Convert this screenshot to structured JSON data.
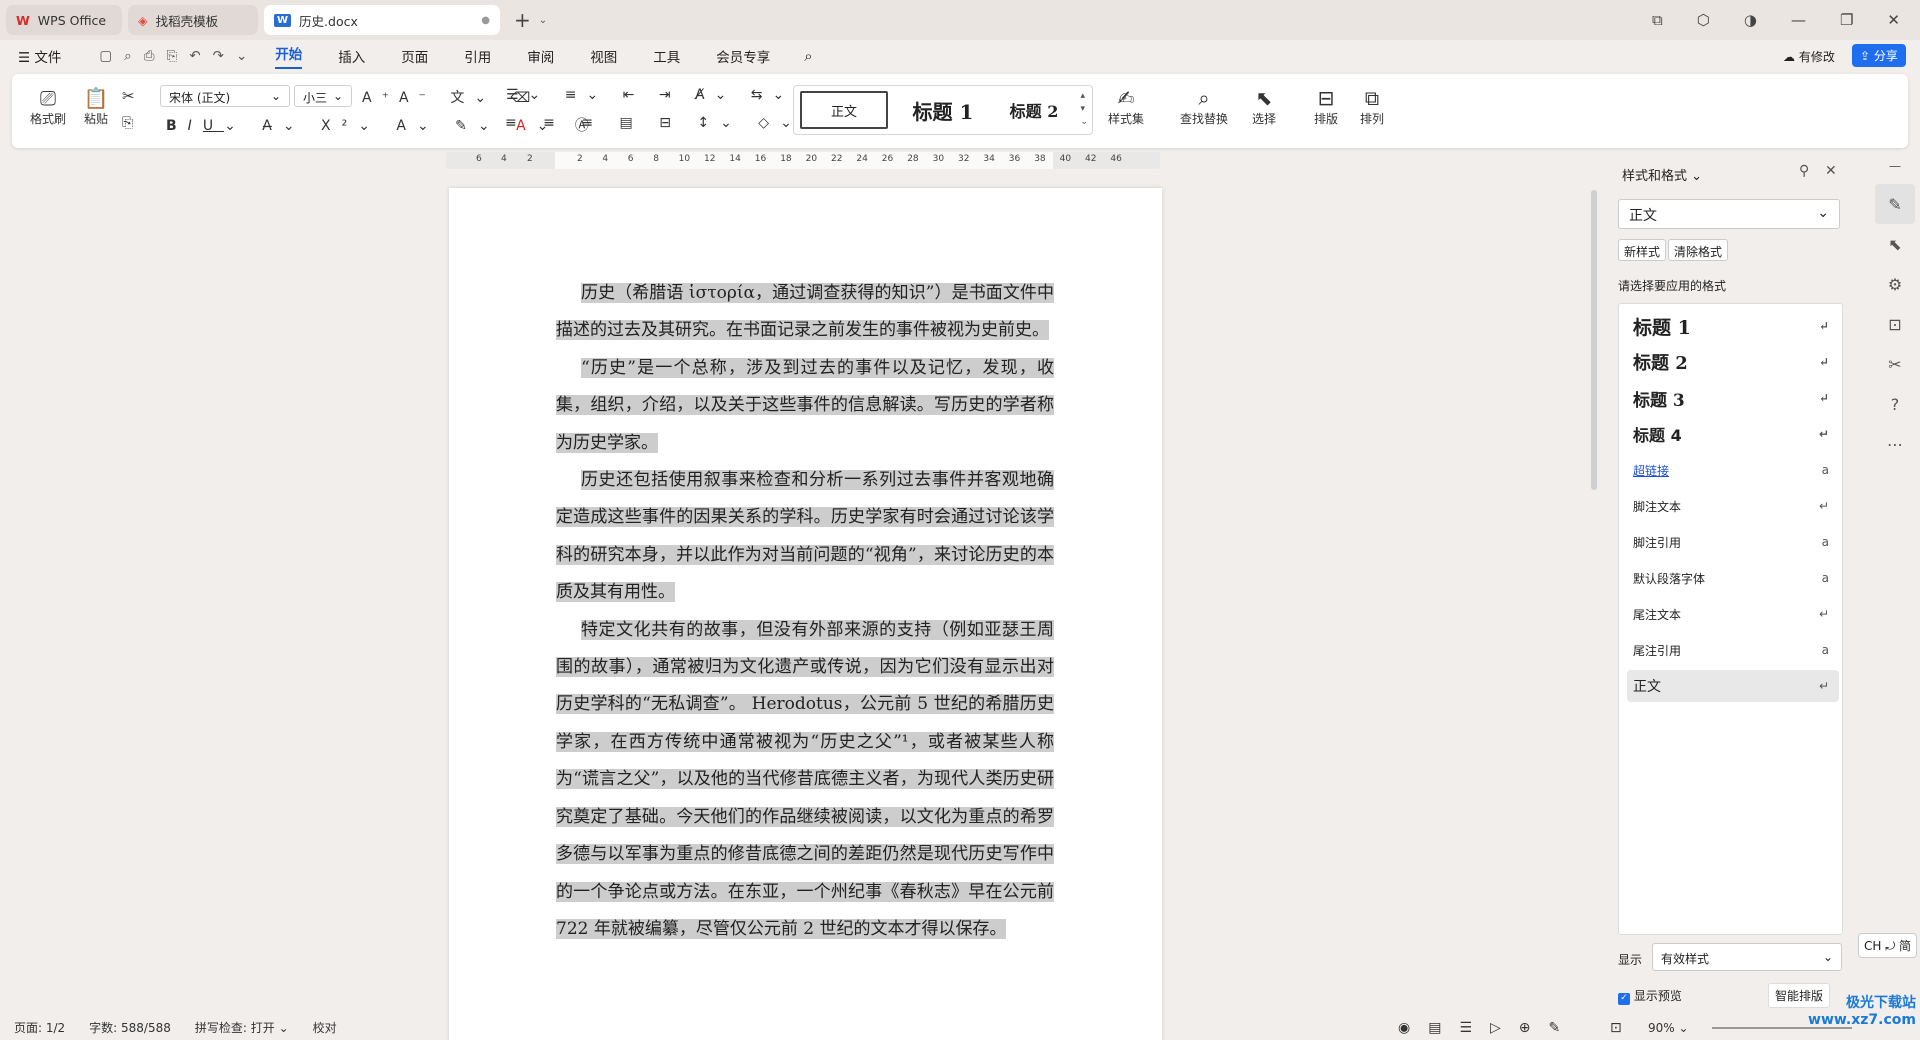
{
  "tabs": [
    {
      "label": "WPS Office",
      "icon": "wps-logo-icon"
    },
    {
      "label": "找稻壳模板",
      "icon": "daoke-icon"
    },
    {
      "label": "历史.docx",
      "icon": "word-doc-icon"
    }
  ],
  "menu": {
    "file": "文件",
    "items": [
      "开始",
      "插入",
      "页面",
      "引用",
      "审阅",
      "视图",
      "工具",
      "会员专享"
    ],
    "active": "开始",
    "modified": "有修改",
    "share": "分享"
  },
  "ribbon": {
    "format_painter": "格式刷",
    "paste": "粘贴",
    "font": "宋体 (正文)",
    "size": "小三",
    "styles_label": "样式集",
    "find_replace": "查找替换",
    "select": "选择",
    "layout": "排版",
    "arrange": "排列",
    "style_samples": [
      "正文",
      "标题 1",
      "标题 2"
    ]
  },
  "ruler": {
    "left_marks": [
      "6",
      "4",
      "2"
    ],
    "marks": [
      "2",
      "4",
      "6",
      "8",
      "10",
      "12",
      "14",
      "16",
      "18",
      "20",
      "22",
      "24",
      "26",
      "28",
      "30",
      "32",
      "34",
      "36",
      "38",
      "40",
      "42",
      "46"
    ]
  },
  "document": {
    "paragraphs": [
      "历史（希腊语 ἱστορία，通过调查获得的知识”）是书面文件中描述的过去及其研究。在书面记录之前发生的事件被视为史前史。",
      "“历史”是一个总称，涉及到过去的事件以及记忆，发现，收集，组织，介绍，以及关于这些事件的信息解读。写历史的学者称为历史学家。",
      "历史还包括使用叙事来检查和分析一系列过去事件并客观地确定造成这些事件的因果关系的学科。历史学家有时会通过讨论该学科的研究本身，并以此作为对当前问题的“视角”，来讨论历史的本质及其有用性。",
      "特定文化共有的故事，但没有外部来源的支持（例如亚瑟王周围的故事），通常被归为文化遗产或传说，因为它们没有显示出对历史学科的“无私调查”。 Herodotus，公元前 5 世纪的希腊历史学家，在西方传统中通常被视为“历史之父”¹，或者被某些人称为“谎言之父”，以及他的当代修昔底德主义者，为现代人类历史研究奠定了基础。今天他们的作品继续被阅读，以文化为重点的希罗多德与以军事为重点的修昔底德之间的差距仍然是现代历史写作中的一个争论点或方法。在东亚，一个州纪事《春秋志》早在公元前 722 年就被编纂，尽管仅公元前 2 世纪的文本才得以保存。"
    ]
  },
  "panel": {
    "title": "样式和格式",
    "current": "正文",
    "new_style": "新样式",
    "clear_format": "清除格式",
    "hint": "请选择要应用的格式",
    "styles": [
      "标题 1",
      "标题 2",
      "标题 3",
      "标题 4",
      "超链接",
      "脚注文本",
      "脚注引用",
      "默认段落字体",
      "尾注文本",
      "尾注引用",
      "正文"
    ],
    "show_label": "显示",
    "show_value": "有效样式",
    "preview_label": "显示预览",
    "smart_layout": "智能排版"
  },
  "ime": "CH ⤾ 简",
  "status": {
    "page": "页面: 1/2",
    "words": "字数: 588/588",
    "spell": "拼写检查: 打开",
    "proof": "校对",
    "zoom": "90%"
  },
  "watermark": "极光下载站 www.xz7.com"
}
